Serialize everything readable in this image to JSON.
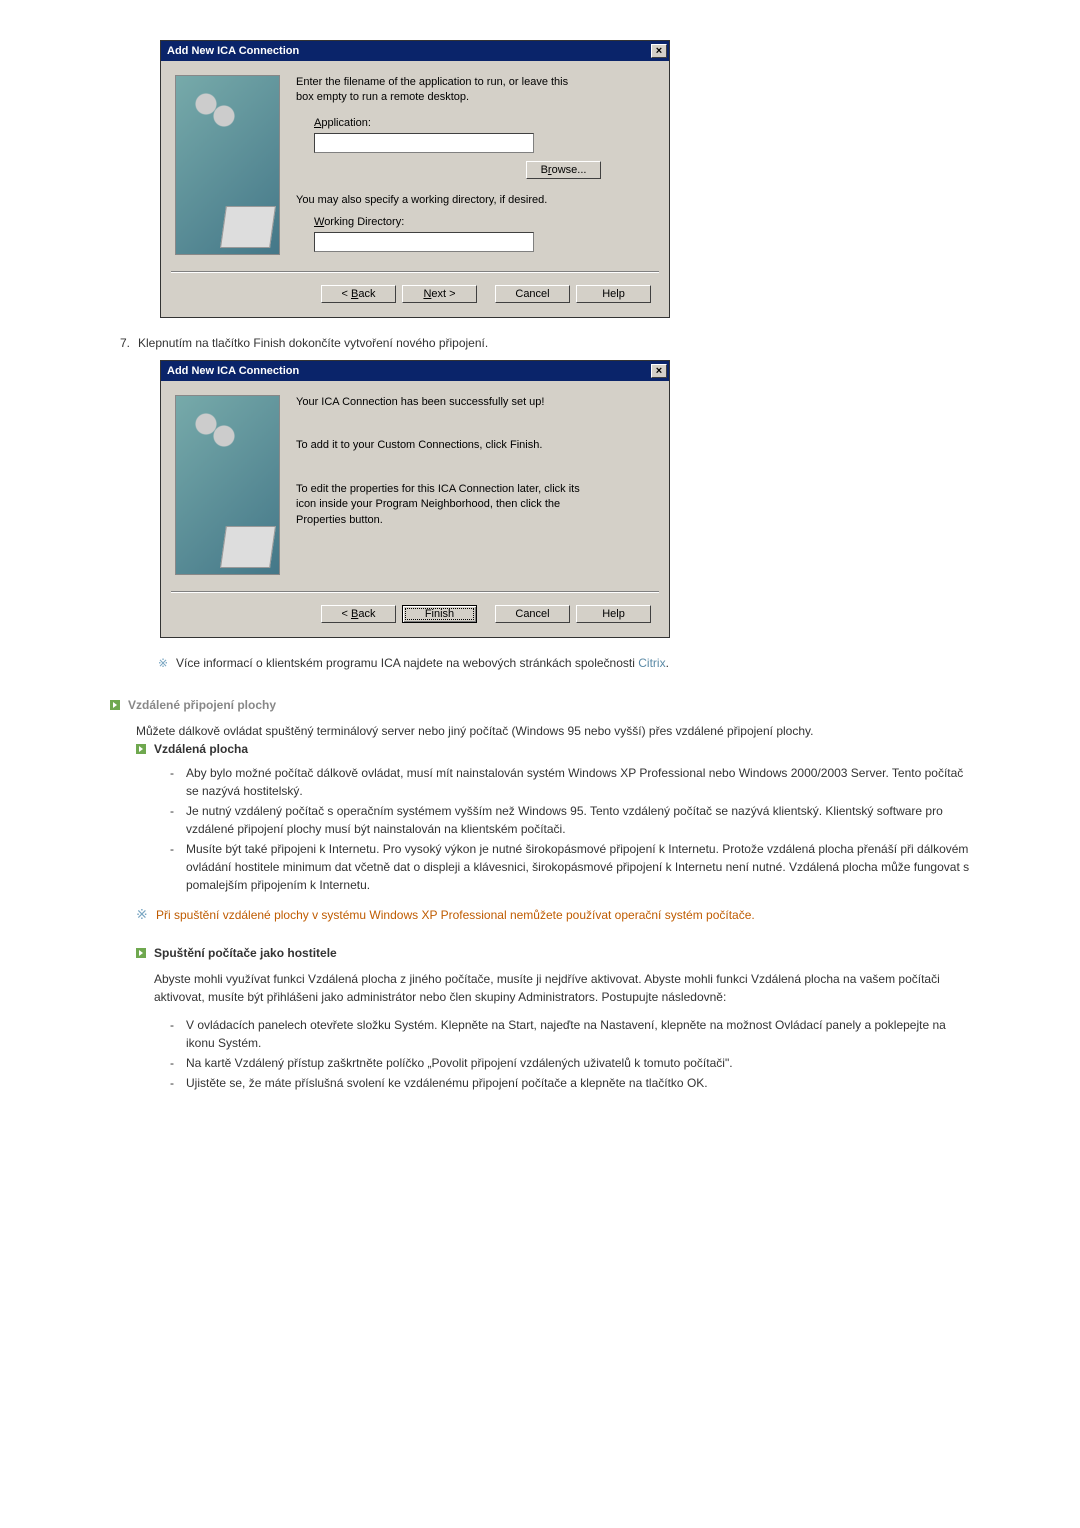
{
  "dialog1": {
    "title": "Add New ICA Connection",
    "intro": "Enter the filename of the application to run, or leave this box empty to run a remote desktop.",
    "app_accesskey": "A",
    "app_rest": "pplication:",
    "browse_accesskey": "r",
    "browse_before": "B",
    "browse_after": "owse...",
    "working_intro": "You may also specify a working directory, if desired.",
    "working_accesskey": "W",
    "working_rest": "orking Directory:",
    "back_ak": "B",
    "back_rest_before": "< ",
    "back_rest_after": "ack",
    "next_ak": "N",
    "next_rest": "ext >",
    "cancel": "Cancel",
    "help": "Help"
  },
  "step7": {
    "num": "7.",
    "text": "Klepnutím na tlačítko Finish dokončíte vytvoření nového připojení."
  },
  "dialog2": {
    "title": "Add New ICA Connection",
    "l1": "Your ICA Connection has been successfully set up!",
    "l2": "To add it to your Custom Connections, click Finish.",
    "l3": "To edit the properties for this ICA Connection later, click its icon inside your Program Neighborhood, then click the Properties button.",
    "back_ak": "B",
    "back_rest_before": "< ",
    "back_rest_after": "ack",
    "finish": "Finish",
    "cancel": "Cancel",
    "help": "Help"
  },
  "citrix_note": {
    "text_before": "Více informací o klientském programu ICA najdete na webových stránkách společnosti ",
    "link": "Citrix",
    "text_after": "."
  },
  "sec1": "Vzdálené připojení plochy",
  "sec1_body": "Můžete dálkově ovládat spuštěný terminálový server nebo jiný počítač (Windows 95 nebo vyšší) přes vzdálené připojení plochy.",
  "sub_remote": "Vzdálená plocha",
  "remote_items": [
    "Aby bylo možné počítač dálkově ovládat, musí mít nainstalován systém Windows XP Professional nebo Windows 2000/2003 Server. Tento počítač se nazývá hostitelský.",
    "Je nutný vzdálený počítač s operačním systémem vyšším než Windows 95. Tento vzdálený počítač se nazývá klientský. Klientský software pro vzdálené připojení plochy musí být nainstalován na klientském počítači.",
    "Musíte být také připojeni k Internetu. Pro vysoký výkon je nutné širokopásmové připojení k Internetu. Protože vzdálená plocha přenáší při dálkovém ovládání hostitele minimum dat včetně dat o displeji a klávesnici, širokopásmové připojení k Internetu není nutné. Vzdálená plocha může fungovat s pomalejším připojením k Internetu."
  ],
  "warn1": "Při spuštění vzdálené plochy v systému Windows XP Professional nemůžete používat operační systém počítače.",
  "sub_host": "Spuštění počítače jako hostitele",
  "host_body": "Abyste mohli využívat funkci Vzdálená plocha z jiného počítače, musíte ji nejdříve aktivovat. Abyste mohli funkci Vzdálená plocha na vašem počítači aktivovat, musíte být přihlášeni jako administrátor nebo člen skupiny Administrators. Postupujte následovně:",
  "host_items": [
    "V ovládacích panelech otevřete složku Systém. Klepněte na Start, najeďte na Nastavení, klepněte na možnost Ovládací panely a poklepejte na ikonu Systém.",
    "Na kartě Vzdálený přístup zaškrtněte políčko „Povolit připojení vzdálených uživatelů k tomuto počítači\".",
    "Ujistěte se, že máte příslušná svolení ke vzdálenému připojení počítače a klepněte na tlačítko OK."
  ]
}
